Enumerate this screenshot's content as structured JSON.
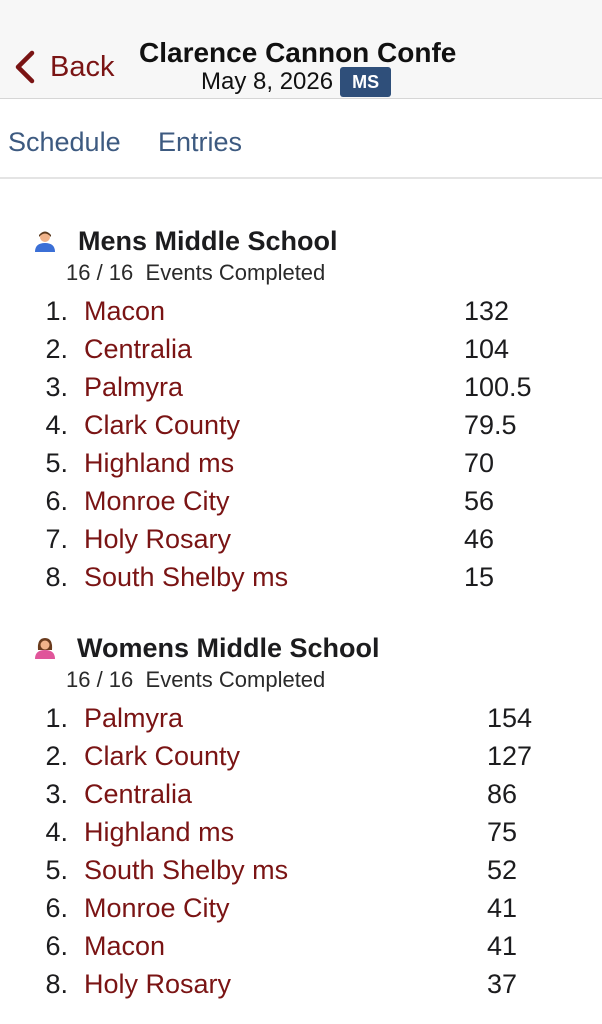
{
  "navbar": {
    "back_label": "Back",
    "title": "Clarence Cannon Confe",
    "date": "May 8, 2026",
    "badge": "MS"
  },
  "tabs": [
    {
      "label": "Schedule"
    },
    {
      "label": "Entries"
    }
  ],
  "sections": [
    {
      "title": "Mens Middle School",
      "icon": "boy-person-icon",
      "events_completed": "16 / 16",
      "events_label": "Events Completed",
      "rows": [
        {
          "rank": "1.",
          "team": "Macon",
          "score": "132"
        },
        {
          "rank": "2.",
          "team": "Centralia",
          "score": "104"
        },
        {
          "rank": "3.",
          "team": "Palmyra",
          "score": "100.5"
        },
        {
          "rank": "4.",
          "team": "Clark County",
          "score": "79.5"
        },
        {
          "rank": "5.",
          "team": "Highland ms",
          "score": "70"
        },
        {
          "rank": "6.",
          "team": "Monroe City",
          "score": "56"
        },
        {
          "rank": "7.",
          "team": "Holy Rosary",
          "score": "46"
        },
        {
          "rank": "8.",
          "team": "South Shelby ms",
          "score": "15"
        }
      ]
    },
    {
      "title": "Womens Middle School",
      "icon": "girl-person-icon",
      "events_completed": "16 / 16",
      "events_label": "Events Completed",
      "rows": [
        {
          "rank": "1.",
          "team": "Palmyra",
          "score": "154"
        },
        {
          "rank": "2.",
          "team": "Clark County",
          "score": "127"
        },
        {
          "rank": "3.",
          "team": "Centralia",
          "score": "86"
        },
        {
          "rank": "4.",
          "team": "Highland ms",
          "score": "75"
        },
        {
          "rank": "5.",
          "team": "South Shelby ms",
          "score": "52"
        },
        {
          "rank": "6.",
          "team": "Monroe City",
          "score": "41"
        },
        {
          "rank": "6.",
          "team": "Macon",
          "score": "41"
        },
        {
          "rank": "8.",
          "team": "Holy Rosary",
          "score": "37"
        }
      ]
    }
  ],
  "colors": {
    "team_link": "#7a1414",
    "tab_link": "#3d5a80",
    "badge_bg": "#2f4f7a"
  }
}
